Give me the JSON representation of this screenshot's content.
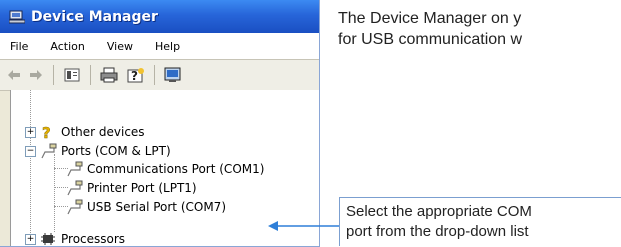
{
  "window": {
    "title": "Device Manager",
    "menu": [
      "File",
      "Action",
      "View",
      "Help"
    ],
    "toolbar_icons": [
      "back-arrow-icon",
      "forward-arrow-icon",
      "properties-icon",
      "print-icon",
      "help-icon",
      "scan-hardware-icon"
    ]
  },
  "tree": {
    "items": [
      {
        "label": "Other devices",
        "icon": "unknown-device-icon",
        "expanded": false
      },
      {
        "label": "Ports (COM & LPT)",
        "icon": "port-icon",
        "expanded": true
      },
      {
        "label": "Communications Port (COM1)",
        "icon": "port-icon"
      },
      {
        "label": "Printer Port (LPT1)",
        "icon": "port-icon"
      },
      {
        "label": "USB Serial Port (COM7)",
        "icon": "port-icon"
      },
      {
        "label": "Processors",
        "icon": "processor-icon",
        "expanded": false
      }
    ]
  },
  "description": {
    "line1": "The Device Manager on y",
    "line2": "for USB communication w"
  },
  "callout": {
    "line1": "Select the appropriate COM",
    "line2": "port from the drop-down list"
  },
  "colors": {
    "titlebar": "#2765d9",
    "callout_border": "#7b9fd0",
    "arrow": "#2e7fd8"
  }
}
